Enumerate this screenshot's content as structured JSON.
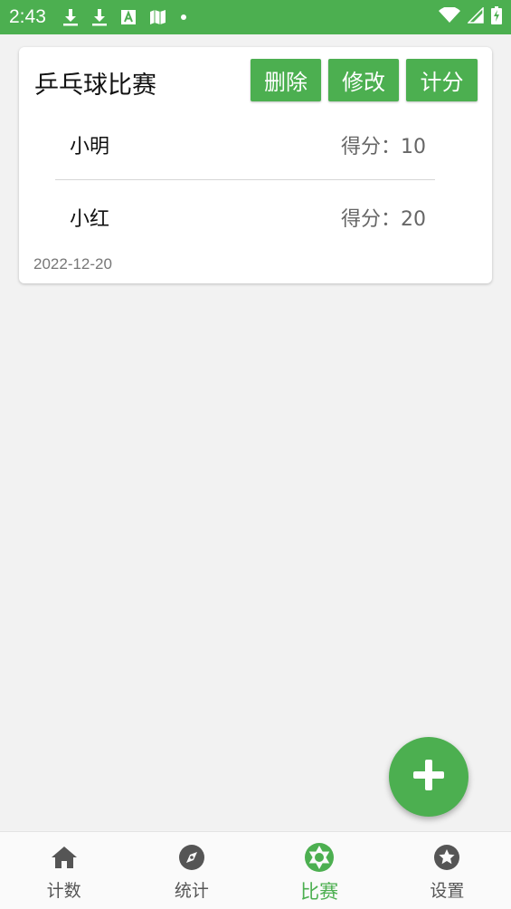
{
  "status_bar": {
    "time": "2:43",
    "accent_color": "#4caf50",
    "left_icons": [
      "download-icon",
      "download-icon",
      "font-app-icon",
      "map-icon",
      "dot-icon"
    ],
    "right_icons": [
      "wifi-icon",
      "signal-icon",
      "battery-charging-icon"
    ]
  },
  "match_card": {
    "title": "乒乓球比赛",
    "buttons": {
      "delete_label": "删除",
      "edit_label": "修改",
      "score_label": "计分"
    },
    "players": [
      {
        "name": "小明",
        "score_text": "得分：10"
      },
      {
        "name": "小红",
        "score_text": "得分：20"
      }
    ],
    "date": "2022-12-20"
  },
  "fab": {
    "icon": "plus-icon"
  },
  "bottom_nav": {
    "active_color": "#4caf50",
    "items": [
      {
        "label": "计数",
        "icon": "home-icon",
        "active": false
      },
      {
        "label": "统计",
        "icon": "compass-icon",
        "active": false
      },
      {
        "label": "比赛",
        "icon": "aperture-icon",
        "active": true
      },
      {
        "label": "设置",
        "icon": "star-circle-icon",
        "active": false
      }
    ]
  }
}
